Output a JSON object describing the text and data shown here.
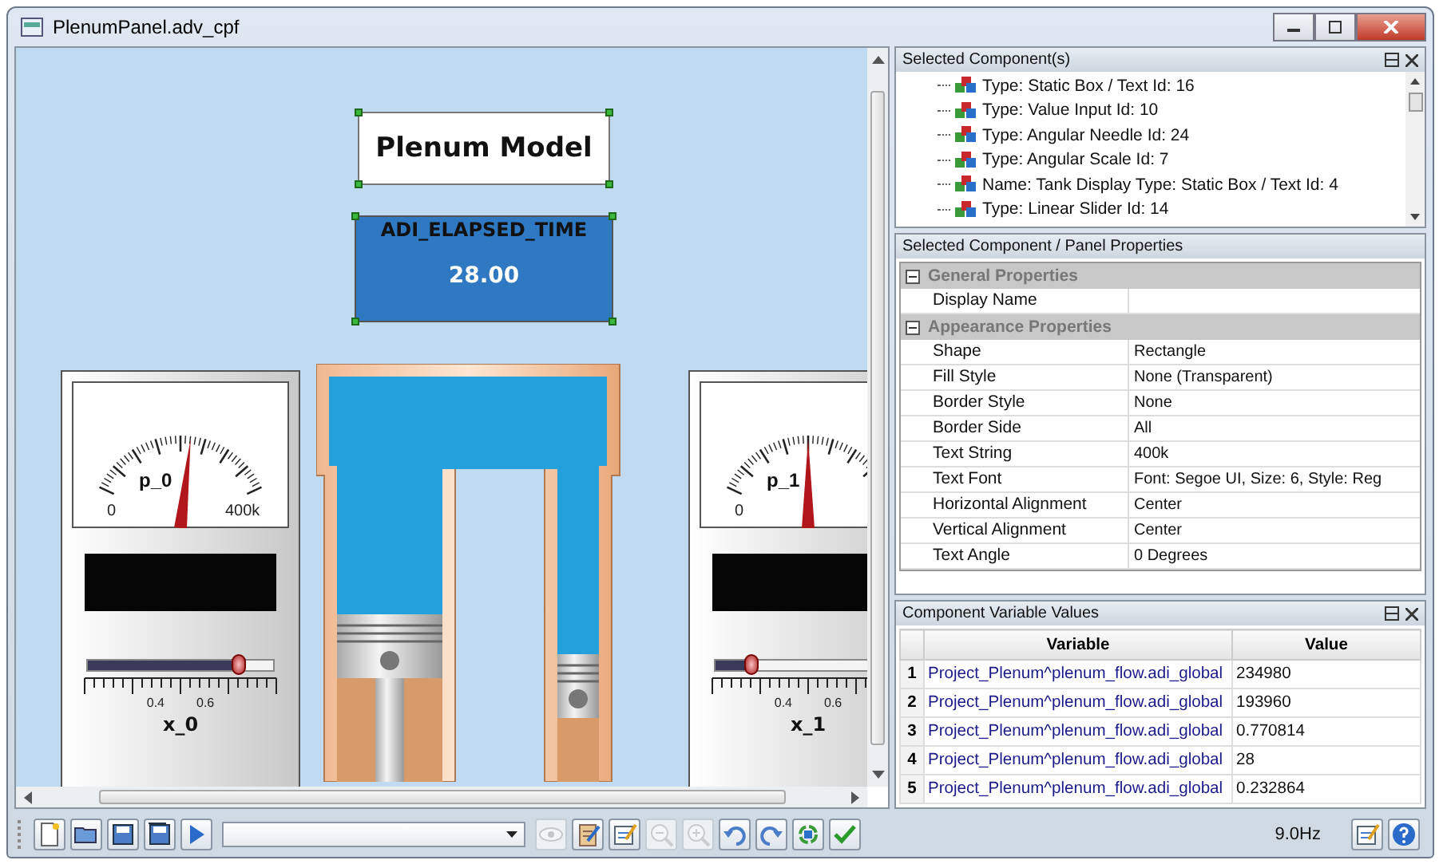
{
  "window": {
    "title": "PlenumPanel.adv_cpf"
  },
  "canvas": {
    "title_box": {
      "text": "Plenum Model"
    },
    "time_display": {
      "label": "ADI_ELAPSED_TIME",
      "value": "28.00"
    },
    "gauges": [
      {
        "dial_label": "p_0",
        "scale_min": "0",
        "scale_max": "400k",
        "dial": {
          "level": 0.55
        },
        "slider": {
          "level": 0.82
        },
        "slider_ticks": [
          "0.4",
          "0.6"
        ],
        "slider_label": "x_0"
      },
      {
        "dial_label": "p_1",
        "scale_min": "0",
        "dial": {
          "level": 0.5
        },
        "slider": {
          "level": 0.2
        },
        "slider_ticks": [
          "0.4",
          "0.6"
        ],
        "slider_label": "x_1"
      }
    ]
  },
  "components_panel": {
    "title": "Selected Component(s)",
    "items": [
      "Type: Static Box / Text  Id: 16",
      "Type: Value Input  Id: 10",
      "Type: Angular Needle  Id: 24",
      "Type: Angular Scale  Id: 7",
      "Name: Tank Display  Type: Static Box / Text  Id: 4",
      "Type: Linear Slider  Id: 14"
    ]
  },
  "properties_panel": {
    "title": "Selected Component / Panel Properties",
    "groups": [
      {
        "name": "General Properties",
        "expanded": true,
        "rows": [
          {
            "name": "Display Name"
          }
        ]
      },
      {
        "name": "Appearance Properties",
        "expanded": true,
        "rows": [
          {
            "name": "Shape",
            "value": "Rectangle"
          },
          {
            "name": "Fill Style",
            "value": "None (Transparent)"
          },
          {
            "name": "Border Style",
            "value": "None"
          },
          {
            "name": "Border Side",
            "value": "All"
          },
          {
            "name": "Text String",
            "value": "400k"
          },
          {
            "name": "Text Font",
            "value": "Font: Segoe UI, Size: 6, Style: Reg"
          },
          {
            "name": "Horizontal Alignment",
            "value": "Center"
          },
          {
            "name": "Vertical Alignment",
            "value": "Center"
          },
          {
            "name": "Text Angle",
            "value": "0 Degrees"
          }
        ]
      }
    ]
  },
  "variables_panel": {
    "title": "Component Variable Values",
    "columns": [
      "Variable",
      "Value"
    ],
    "rows": [
      {
        "index": "1",
        "variable": "Project_Plenum^plenum_flow.adi_global",
        "value": "234980"
      },
      {
        "index": "2",
        "variable": "Project_Plenum^plenum_flow.adi_global",
        "value": "193960"
      },
      {
        "index": "3",
        "variable": "Project_Plenum^plenum_flow.adi_global",
        "value": "0.770814"
      },
      {
        "index": "4",
        "variable": "Project_Plenum^plenum_flow.adi_global",
        "value": "28"
      },
      {
        "index": "5",
        "variable": "Project_Plenum^plenum_flow.adi_global",
        "value": "0.232864"
      }
    ]
  },
  "toolbar": {
    "items": [
      {
        "kind": "new",
        "disabled": false
      },
      {
        "kind": "open",
        "disabled": false
      },
      {
        "kind": "save",
        "disabled": false
      },
      {
        "kind": "save-all",
        "disabled": false
      },
      {
        "kind": "run",
        "disabled": false
      },
      {
        "kind": "dropdown"
      },
      {
        "kind": "view",
        "disabled": true
      },
      {
        "kind": "properties",
        "disabled": false
      },
      {
        "kind": "edit",
        "disabled": false
      },
      {
        "kind": "zoom-out",
        "disabled": true
      },
      {
        "kind": "zoom-in",
        "disabled": true
      },
      {
        "kind": "undo",
        "disabled": false
      },
      {
        "kind": "redo",
        "disabled": false
      },
      {
        "kind": "refresh",
        "disabled": false
      },
      {
        "kind": "check",
        "disabled": false
      }
    ],
    "status": "9.0Hz",
    "right_items": [
      {
        "kind": "edit",
        "disabled": false
      },
      {
        "kind": "help",
        "disabled": false
      }
    ]
  }
}
